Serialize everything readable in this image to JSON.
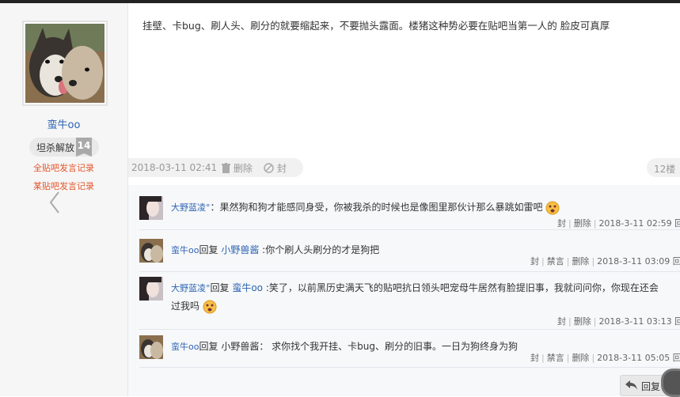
{
  "author": {
    "name": "蛮牛oo",
    "title_badge": "坦杀解放",
    "level": "14",
    "link_all": "全贴吧发言记录",
    "link_this": "某贴吧发言记录"
  },
  "post": {
    "content": "挂壁、卡bug、刷人头、刷分的就要缩起来，不要抛头露面。楼猪这种势必要在贴吧当第一人的 脸皮可真厚",
    "date": "2018-03-11 02:41",
    "delete_label": "删除",
    "ban_label": "封",
    "floor": "12楼"
  },
  "replies": [
    {
      "user": "大野蓝凌°",
      "text": "：果然狗和狗才能感同身受，你被我杀的时候也是像图里那伙计那么暴跳如雷吧",
      "has_emoji": true,
      "actions": [
        "封",
        "删除"
      ],
      "date": "2018-3-11 02:59",
      "reply_label": "回复"
    },
    {
      "user": "蛮牛oo",
      "reply_word": "回复",
      "target": "小野兽酱",
      "text": ":你个刷人头刷分的才是狗把",
      "actions": [
        "封",
        "禁言",
        "删除"
      ],
      "date": "2018-3-11 03:09",
      "reply_label": "回复"
    },
    {
      "user": "大野蓝凌°",
      "reply_word": "回复",
      "target": "蛮牛oo",
      "text": ":笑了，以前黑历史满天飞的贴吧抗日领头吧宠母牛居然有脸提旧事，我就问问你，你现在还会",
      "text2": "过我吗",
      "has_emoji": true,
      "actions": [
        "封",
        "删除"
      ],
      "date": "2018-3-11 03:13",
      "reply_label": "回复"
    },
    {
      "user": "蛮牛oo",
      "reply_word": "回复",
      "target": "小野兽酱",
      "text": "： 求你找个我开挂、卡bug、刷分的旧事。一日为狗终身为狗",
      "actions": [
        "封",
        "禁言",
        "删除"
      ],
      "date": "2018-3-11 05:05",
      "reply_label": "回复"
    }
  ],
  "reply_button": "回复",
  "colors": {
    "link": "#2d64b3",
    "accent_red": "#e4562b",
    "meta_gray": "#999999"
  }
}
